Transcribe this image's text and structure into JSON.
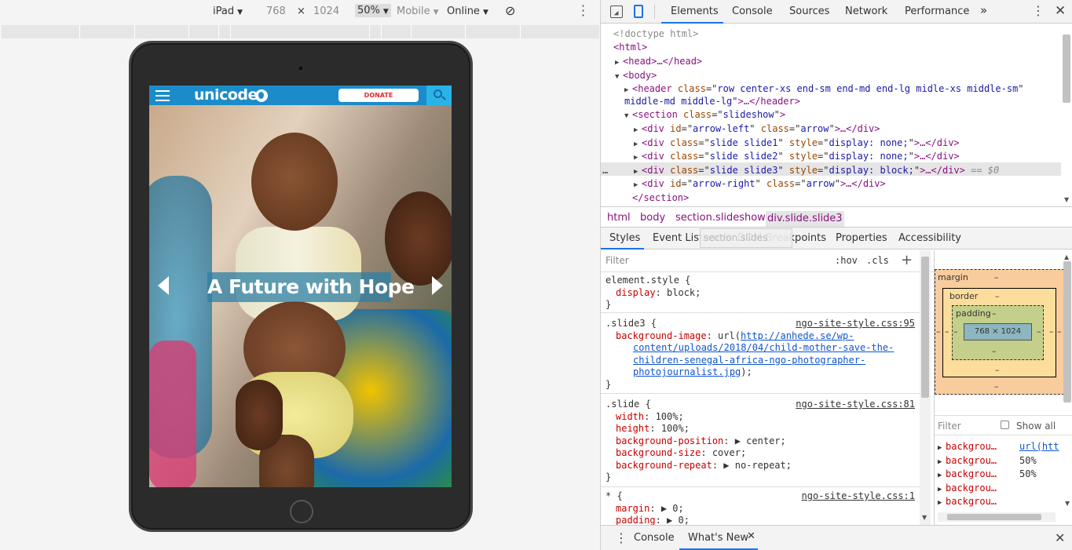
{
  "device_toolbar": {
    "device": "iPad",
    "width": "768",
    "times": "×",
    "height": "1024",
    "zoom": "50%",
    "mode": "Mobile",
    "network": "Online"
  },
  "site": {
    "logo": "unicode",
    "donate_label": "DONATE",
    "headline": "A Future with Hope"
  },
  "devtools": {
    "tabs": [
      "Elements",
      "Console",
      "Sources",
      "Network",
      "Performance"
    ],
    "more_tabs": "»",
    "dom": [
      {
        "indent": 0,
        "html": "<!doctype html>"
      },
      {
        "indent": 0,
        "html": "<html>"
      },
      {
        "indent": 1,
        "tri": "▶",
        "tag": "<head>…</head>"
      },
      {
        "indent": 1,
        "tri": "▼",
        "tag": "<body>"
      },
      {
        "indent": 2,
        "tri": "▶",
        "open": "<header",
        "attrs": [
          [
            "class",
            "row center-xs end-sm end-md end-lg midle-xs middle-sm"
          ]
        ]
      },
      {
        "indent": 2,
        "cont": "middle-md middle-lg\">…</header>"
      },
      {
        "indent": 2,
        "tri": "▼",
        "open": "<section",
        "attrs": [
          [
            "class",
            "slideshow"
          ]
        ],
        "close": ">"
      },
      {
        "indent": 3,
        "tri": "▶",
        "open": "<div",
        "attrs": [
          [
            "id",
            "arrow-left"
          ],
          [
            "class",
            "arrow"
          ]
        ],
        "close": ">…</div>"
      },
      {
        "indent": 3,
        "tri": "▶",
        "open": "<div",
        "attrs": [
          [
            "class",
            "slide slide1"
          ],
          [
            "style",
            "display: none;"
          ]
        ],
        "close": ">…</div>"
      },
      {
        "indent": 3,
        "tri": "▶",
        "open": "<div",
        "attrs": [
          [
            "class",
            "slide slide2"
          ],
          [
            "style",
            "display: none;"
          ]
        ],
        "close": ">…</div>"
      },
      {
        "indent": 3,
        "tri": "▶",
        "open": "<div",
        "attrs": [
          [
            "class",
            "slide slide3"
          ],
          [
            "style",
            "display: block;"
          ]
        ],
        "close": ">…</div>",
        "suffix": " == $0",
        "selected": true
      },
      {
        "indent": 3,
        "tri": "▶",
        "open": "<div",
        "attrs": [
          [
            "id",
            "arrow-right"
          ],
          [
            "class",
            "arrow"
          ]
        ],
        "close": ">…</div>"
      },
      {
        "indent": 2,
        "tag": "</section>"
      }
    ],
    "breadcrumbs": [
      "html",
      "body",
      "section.slideshow",
      "div.slide.slide3"
    ],
    "styles_tabs": [
      "Styles",
      "Event Listeners",
      "DOM Breakpoints",
      "Properties",
      "Accessibility"
    ],
    "tooltip": "section.slides",
    "filter_placeholder": "Filter",
    "hov": ":hov",
    "cls": ".cls",
    "rules": [
      {
        "selector": "element.style {",
        "source": "",
        "props": [
          [
            "display",
            "block;"
          ]
        ]
      },
      {
        "selector": ".slide3 {",
        "source": "ngo-site-style.css:95",
        "url_prop": "background-image",
        "url_text": [
          "http://anhede.se/wp-",
          "content/uploads/2018/04/child-mother-save-the-",
          "children-senegal-africa-ngo-photographer-",
          "photojournalist.jpg"
        ]
      },
      {
        "selector": ".slide {",
        "source": "ngo-site-style.css:81",
        "props": [
          [
            "width",
            "100%;"
          ],
          [
            "height",
            "100%;"
          ],
          [
            "background-position",
            "▶ center;"
          ],
          [
            "background-size",
            "cover;"
          ],
          [
            "background-repeat",
            "▶ no-repeat;"
          ]
        ]
      },
      {
        "selector": "* {",
        "source": "ngo-site-style.css:1",
        "props": [
          [
            "margin",
            "▶ 0;"
          ],
          [
            "padding",
            "▶ 0;"
          ]
        ]
      }
    ],
    "box_model": {
      "margin": "margin",
      "border": "border",
      "padding": "padding",
      "dash": "–",
      "content": "768 × 1024"
    },
    "computed_filter": "Filter",
    "show_all": "Show all",
    "computed": [
      {
        "name": "backgrou…",
        "value": "url(htt",
        "url": true
      },
      {
        "name": "backgrou…",
        "value": "50%"
      },
      {
        "name": "backgrou…",
        "value": "50%"
      },
      {
        "name": "backgrou…",
        "value": ""
      },
      {
        "name": "backgrou…",
        "value": ""
      }
    ],
    "drawer": {
      "console": "Console",
      "whats_new": "What's New"
    }
  }
}
